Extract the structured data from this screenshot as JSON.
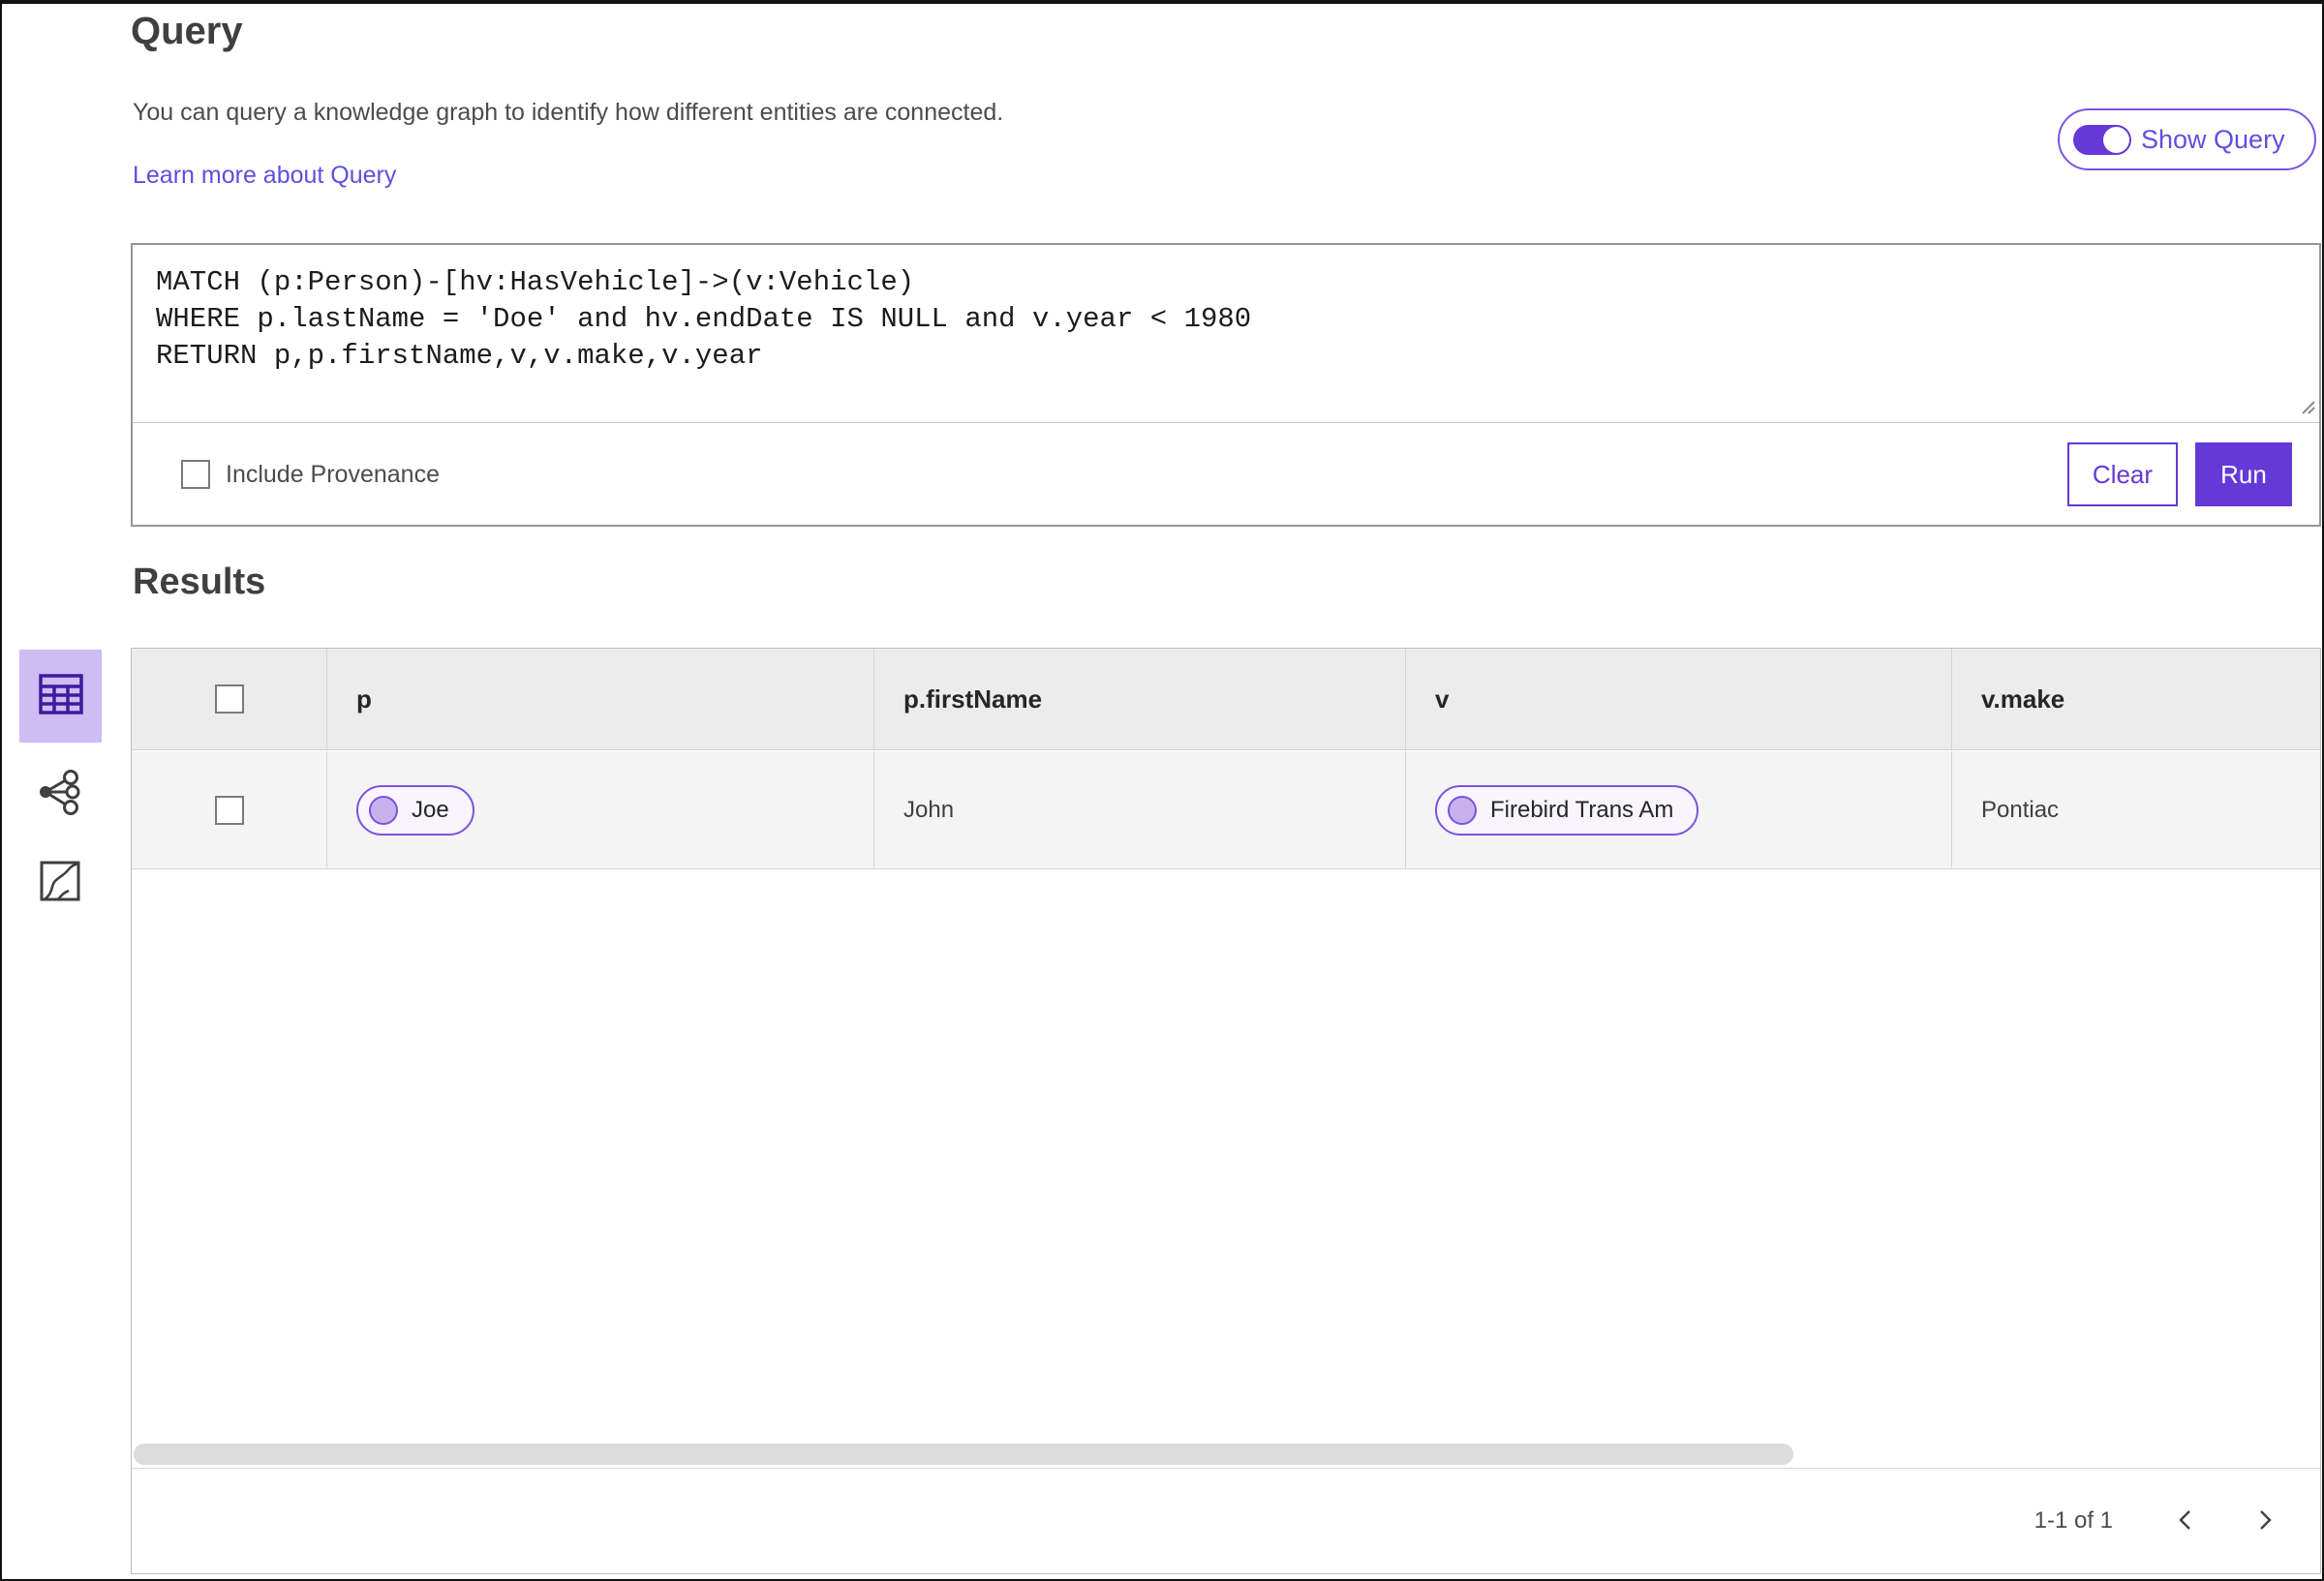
{
  "header": {
    "title": "Query",
    "description": "You can query a knowledge graph to identify how different entities are connected.",
    "learn_more_link": "Learn more about Query",
    "show_query_toggle": {
      "label": "Show Query",
      "state": "on"
    }
  },
  "query_editor": {
    "code": "MATCH (p:Person)-[hv:HasVehicle]->(v:Vehicle)\nWHERE p.lastName = 'Doe' and hv.endDate IS NULL and v.year < 1980\nRETURN p,p.firstName,v,v.make,v.year",
    "include_provenance": {
      "label": "Include Provenance",
      "checked": false
    },
    "clear_label": "Clear",
    "run_label": "Run"
  },
  "results": {
    "title": "Results",
    "view_switcher": [
      {
        "icon": "table-view-icon",
        "selected": true
      },
      {
        "icon": "link-chart-view-icon",
        "selected": false
      },
      {
        "icon": "map-view-icon",
        "selected": false
      }
    ],
    "columns": [
      "p",
      "p.firstName",
      "v",
      "v.make"
    ],
    "rows": [
      {
        "p": "Joe",
        "p_firstName": "John",
        "v": "Firebird Trans Am",
        "v_make": "Pontiac"
      }
    ],
    "pagination": {
      "range_label": "1-1 of 1"
    }
  },
  "colors": {
    "accent_purple": "#6539d6",
    "pill_border_purple": "#7c52dd",
    "selected_tile_bg": "#cebcf4",
    "link_purple": "#5a50dd",
    "table_header_bg": "#ececec",
    "table_row_bg": "#f4f4f4"
  }
}
